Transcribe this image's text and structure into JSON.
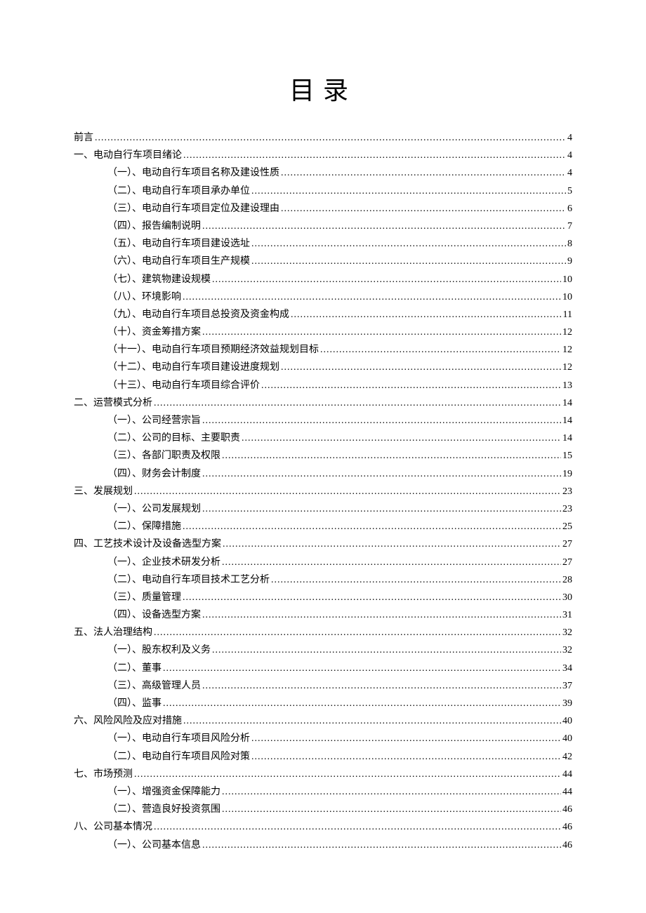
{
  "title": "目录",
  "entries": [
    {
      "level": 1,
      "label": "前言",
      "page": "4"
    },
    {
      "level": 1,
      "label": "一、电动自行车项目绪论",
      "page": "4"
    },
    {
      "level": 2,
      "label": "（一）、电动自行车项目名称及建设性质",
      "page": "4"
    },
    {
      "level": 2,
      "label": "（二）、电动自行车项目承办单位",
      "page": "5"
    },
    {
      "level": 2,
      "label": "（三）、电动自行车项目定位及建设理由",
      "page": "6"
    },
    {
      "level": 2,
      "label": "（四）、报告编制说明",
      "page": "7"
    },
    {
      "level": 2,
      "label": "（五）、电动自行车项目建设选址",
      "page": "8"
    },
    {
      "level": 2,
      "label": "（六）、电动自行车项目生产规模",
      "page": "9"
    },
    {
      "level": 2,
      "label": "（七）、建筑物建设规模",
      "page": "10"
    },
    {
      "level": 2,
      "label": "（八）、环境影响",
      "page": "10"
    },
    {
      "level": 2,
      "label": "（九）、电动自行车项目总投资及资金构成",
      "page": "11"
    },
    {
      "level": 2,
      "label": "（十）、资金筹措方案",
      "page": "12"
    },
    {
      "level": 2,
      "label": "（十一）、电动自行车项目预期经济效益规划目标",
      "page": "12"
    },
    {
      "level": 2,
      "label": "（十二）、电动自行车项目建设进度规划",
      "page": "12"
    },
    {
      "level": 2,
      "label": "（十三）、电动自行车项目综合评价",
      "page": "13"
    },
    {
      "level": 1,
      "label": "二、运营模式分析",
      "page": "14"
    },
    {
      "level": 2,
      "label": "（一）、公司经营宗旨",
      "page": "14"
    },
    {
      "level": 2,
      "label": "（二）、公司的目标、主要职责",
      "page": "14"
    },
    {
      "level": 2,
      "label": "（三）、各部门职责及权限",
      "page": "15"
    },
    {
      "level": 2,
      "label": "（四）、财务会计制度",
      "page": "19"
    },
    {
      "level": 1,
      "label": "三、发展规划",
      "page": "23"
    },
    {
      "level": 2,
      "label": "（一）、公司发展规划",
      "page": "23"
    },
    {
      "level": 2,
      "label": "（二）、保障措施",
      "page": "25"
    },
    {
      "level": 1,
      "label": "四、工艺技术设计及设备选型方案",
      "page": "27"
    },
    {
      "level": 2,
      "label": "（一）、企业技术研发分析",
      "page": "27"
    },
    {
      "level": 2,
      "label": "（二）、电动自行车项目技术工艺分析",
      "page": "28"
    },
    {
      "level": 2,
      "label": "（三）、质量管理",
      "page": "30"
    },
    {
      "level": 2,
      "label": "（四）、设备选型方案",
      "page": "31"
    },
    {
      "level": 1,
      "label": "五、法人治理结构",
      "page": "32"
    },
    {
      "level": 2,
      "label": "（一）、股东权利及义务",
      "page": "32"
    },
    {
      "level": 2,
      "label": "（二）、董事",
      "page": "34"
    },
    {
      "level": 2,
      "label": "（三）、高级管理人员",
      "page": "37"
    },
    {
      "level": 2,
      "label": "（四）、监事",
      "page": "39"
    },
    {
      "level": 1,
      "label": "六、风险风险及应对措施",
      "page": "40"
    },
    {
      "level": 2,
      "label": "（一）、电动自行车项目风险分析",
      "page": "40"
    },
    {
      "level": 2,
      "label": "（二）、电动自行车项目风险对策",
      "page": "42"
    },
    {
      "level": 1,
      "label": "七、市场预测",
      "page": "44"
    },
    {
      "level": 2,
      "label": "（一）、增强资金保障能力",
      "page": "44"
    },
    {
      "level": 2,
      "label": "（二）、营造良好投资氛围",
      "page": "46"
    },
    {
      "level": 1,
      "label": "八、公司基本情况",
      "page": "46"
    },
    {
      "level": 2,
      "label": "（一）、公司基本信息",
      "page": "46"
    }
  ]
}
